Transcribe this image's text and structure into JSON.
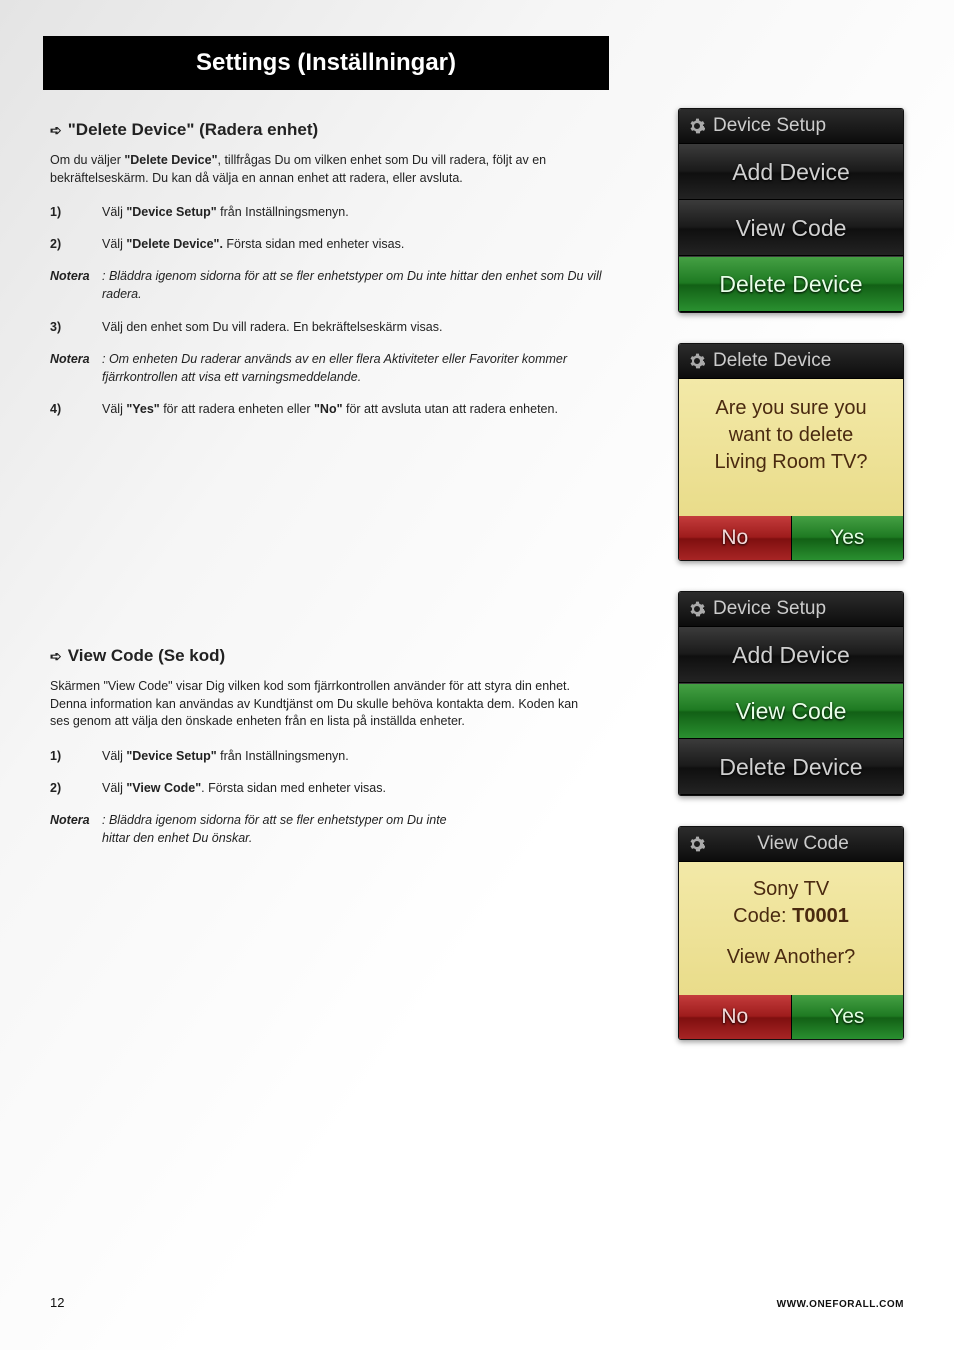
{
  "header": {
    "title": "Settings (Inställningar)"
  },
  "section1": {
    "heading": "\"Delete Device\" (Radera enhet)",
    "intro_pre": "Om du väljer ",
    "intro_bold": "\"Delete Device\"",
    "intro_post": ", tillfrågas Du om vilken enhet som Du vill radera, följt av en bekräftelseskärm. Du kan då välja en annan enhet att radera, eller avsluta.",
    "steps": [
      {
        "num": "1)",
        "pre": "Välj ",
        "bold": "\"Device Setup\"",
        "post": " från Inställningsmenyn."
      },
      {
        "num": "2)",
        "pre": "Välj ",
        "bold": "\"Delete Device\".",
        "post": " Första sidan med enheter visas."
      }
    ],
    "note1_label": "Notera",
    "note1_text": ":  Bläddra igenom sidorna för att se fler enhetstyper om Du inte hittar den enhet som Du vill radera.",
    "step3": {
      "num": "3)",
      "text": "Välj den enhet som Du vill radera. En bekräftelseskärm visas."
    },
    "note2_label": "Notera",
    "note2_text": ":  Om enheten Du raderar används av en eller flera Aktiviteter eller Favoriter kommer fjärrkontrollen att visa ett varningsmeddelande.",
    "step4": {
      "num": "4)",
      "pre": "Välj ",
      "bold1": "\"Yes\"",
      "mid": "  för att radera enheten eller ",
      "bold2": "\"No\"",
      "post": " för att avsluta utan att radera enheten."
    }
  },
  "section2": {
    "heading": "View Code (Se kod)",
    "intro": "Skärmen \"View Code\" visar Dig vilken kod som fjärrkontrollen använder för att styra din enhet. Denna information kan användas av Kundtjänst om Du skulle behöva kontakta dem. Koden kan ses genom att välja den önskade enheten från en lista på inställda enheter.",
    "steps": [
      {
        "num": "1)",
        "pre": "Välj ",
        "bold": "\"Device Setup\"",
        "post": " från Inställningsmenyn."
      },
      {
        "num": "2)",
        "pre": "Välj ",
        "bold": "\"View Code\"",
        "post": ". Första sidan med enheter visas."
      }
    ],
    "note_label": "Notera",
    "note_text": ":  Bläddra igenom sidorna för att se fler enhetstyper om Du inte hittar den enhet Du önskar."
  },
  "screens": {
    "device_setup_title": "Device Setup",
    "add_device": "Add Device",
    "view_code": "View Code",
    "delete_device": "Delete Device",
    "confirm_title": "Delete Device",
    "confirm_line1": "Are you sure you",
    "confirm_line2": "want to delete",
    "confirm_line3": "Living Room TV?",
    "no": "No",
    "yes": "Yes",
    "vc_title": "View Code",
    "vc_line1": "Sony TV",
    "vc_code_label": "Code: ",
    "vc_code_value": "T0001",
    "vc_another": "View Another?"
  },
  "footer": {
    "page_num": "12",
    "url": "WWW.ONEFORALL.COM"
  }
}
